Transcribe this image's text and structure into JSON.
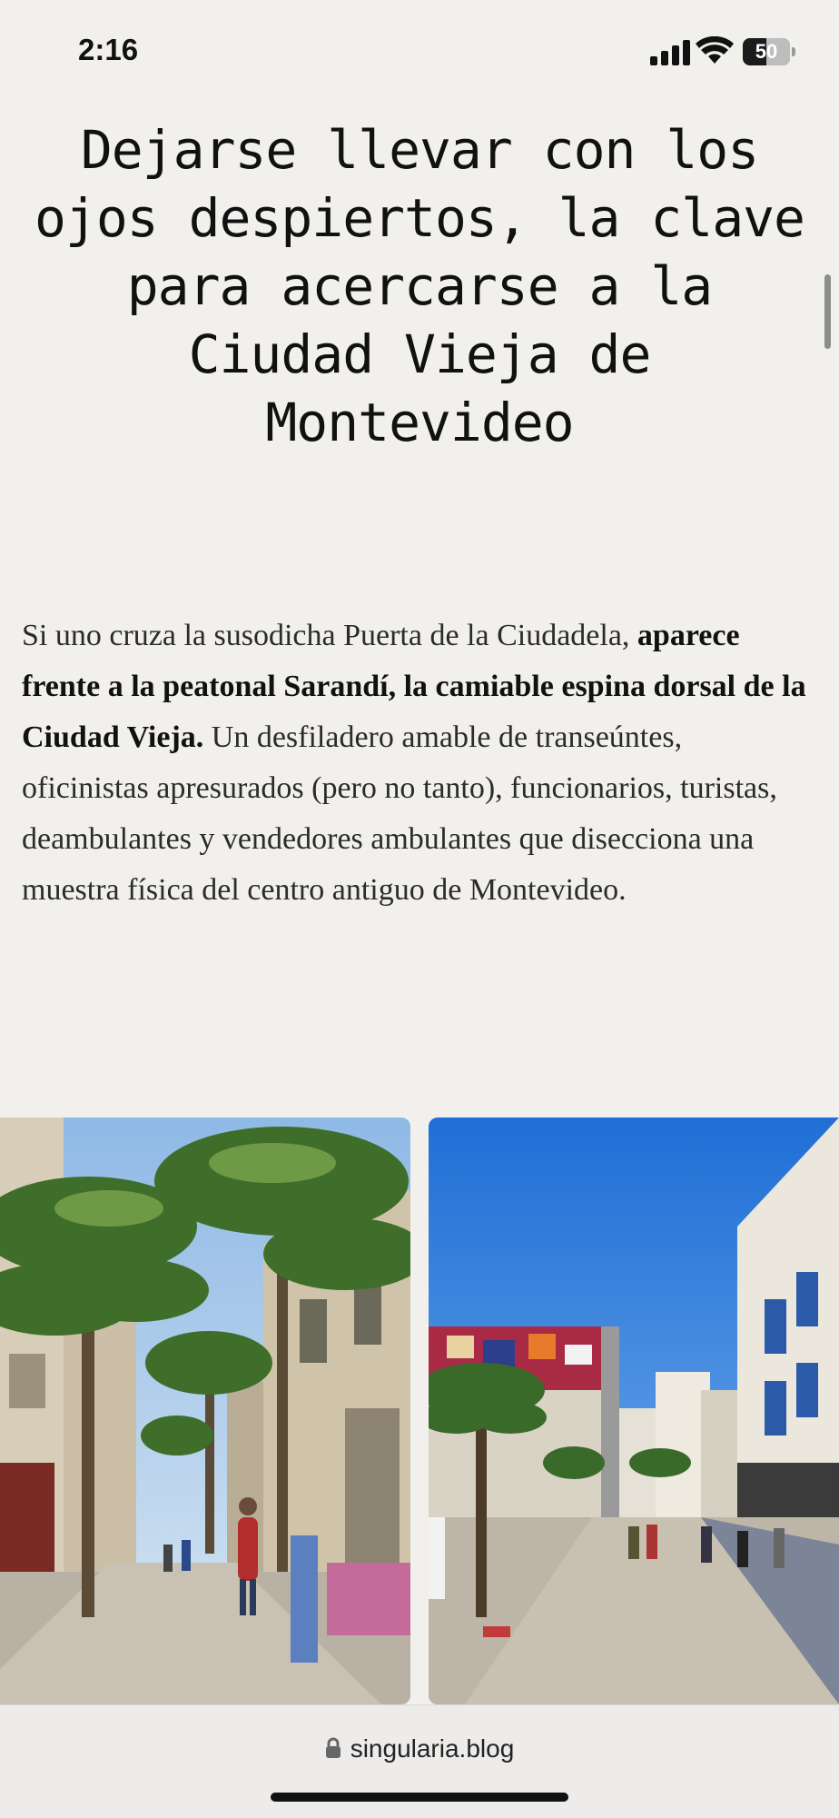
{
  "status_bar": {
    "time": "2:16",
    "battery_level": "50",
    "battery_fraction": 0.5,
    "signal_icon": "cellular-signal-icon",
    "wifi_icon": "wifi-icon",
    "battery_icon": "battery-icon"
  },
  "article": {
    "title": "Dejarse llevar con los ojos despiertos, la clave para acercarse a la Ciudad Vieja de Montevideo",
    "paragraph": {
      "intro": "Si uno cruza la susodicha Puerta de la Ciudadela, ",
      "bold": "aparece frente a la peatonal Sarandí, la camiable espina dorsal de la Ciudad Vieja.",
      "rest": " Un desfiladero amable de transeúntes, oficinistas apresurados (pero no tanto), funcionarios, turistas, deambulantes y vendedores ambulantes que disecciona una muestra física del centro antiguo de Montevideo."
    }
  },
  "colors": {
    "background": "#f2f0ed",
    "sky": "#3d8fe0",
    "palm": "#3f6e2a"
  },
  "browser": {
    "url": "singularia.blog",
    "lock_icon": "lock-icon"
  }
}
